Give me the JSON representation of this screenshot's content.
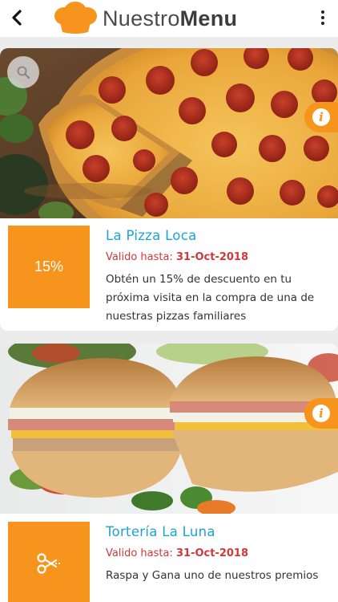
{
  "header": {
    "back_icon": "back-arrow-icon",
    "logo_icon": "chef-hat-icon",
    "title_part1": "Nuestro",
    "title_part2": "Menu",
    "more_icon": "more-vertical-icon"
  },
  "colors": {
    "accent": "#f7941d",
    "title_blue": "#1ba5d3",
    "valid_red": "#d0383a"
  },
  "promos": [
    {
      "image": "pepperoni-pizza-photo",
      "badge_text": "15%",
      "title": "La Pizza Loca",
      "valid_label": "Valido hasta:",
      "valid_date": "31-Oct-2018",
      "description": "Obtén un 15% de descuento en tu próxima visita en la compra de una de nuestras pizzas familiares"
    },
    {
      "image": "tortas-sandwich-photo",
      "badge_icon": "scissors-coupon-icon",
      "title": "Tortería La Luna",
      "valid_label": "Valido hasta:",
      "valid_date": "31-Oct-2018",
      "description": "Raspa y Gana uno de nuestros premios"
    }
  ]
}
